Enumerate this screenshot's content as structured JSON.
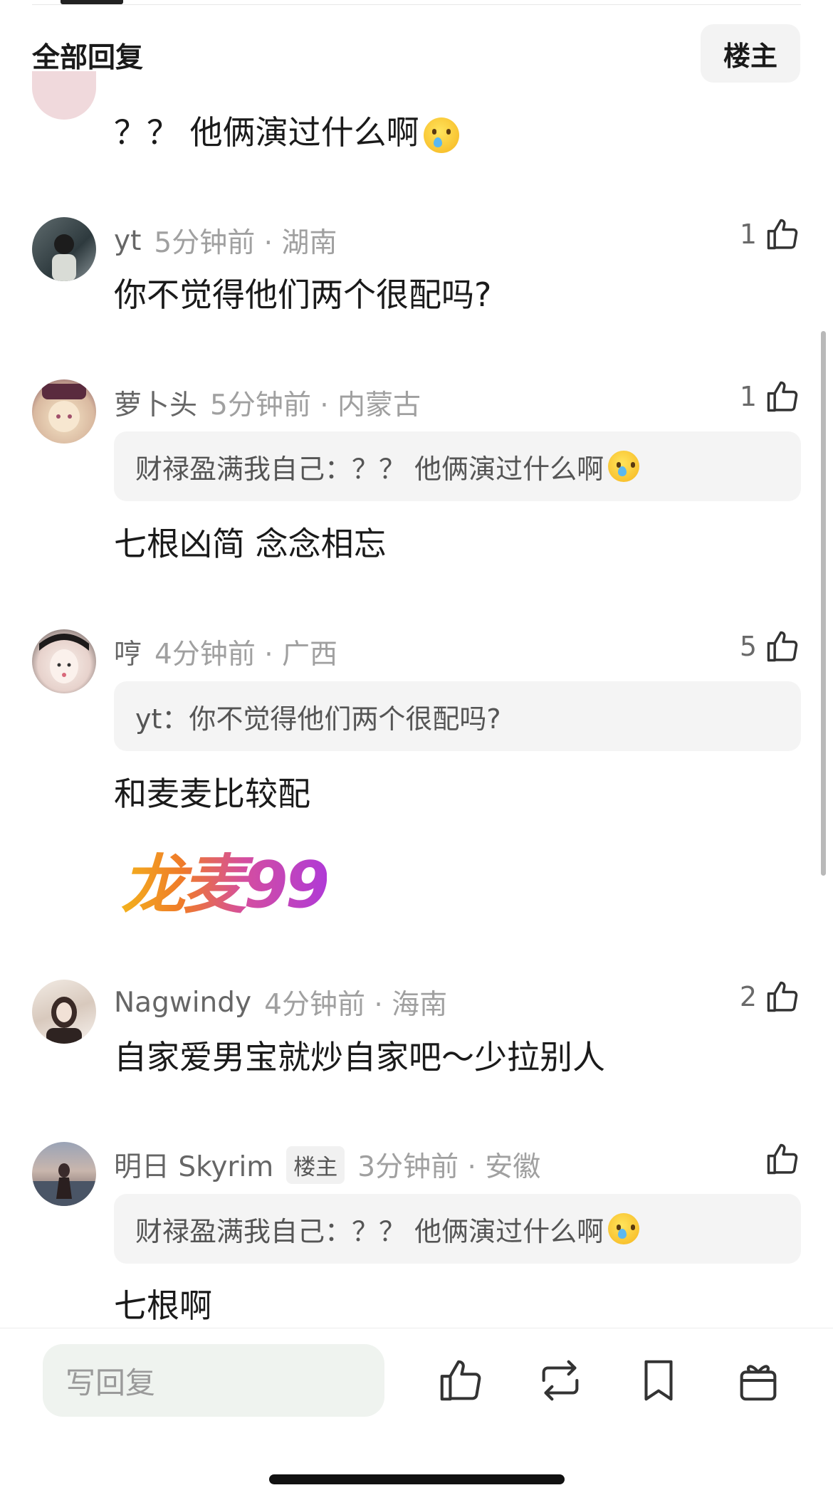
{
  "header": {
    "section_title": "全部回复",
    "filter_chip": "楼主"
  },
  "comments": [
    {
      "body": "？？ 他俩演过什么啊"
    },
    {
      "name": "yt",
      "meta": "5分钟前 · 湖南",
      "likes": "1",
      "body": "你不觉得他们两个很配吗?"
    },
    {
      "name": "萝卜头",
      "meta": "5分钟前 · 内蒙古",
      "likes": "1",
      "quote": "财禄盈满我自己：？？ 他俩演过什么啊",
      "body": "七根凶简 念念相忘"
    },
    {
      "name": "哼",
      "meta": "4分钟前 · 广西",
      "likes": "5",
      "quote": "yt：你不觉得他们两个很配吗?",
      "body": "和麦麦比较配",
      "sticker": "龙麦99"
    },
    {
      "name": "Nagwindy",
      "meta": "4分钟前 · 海南",
      "likes": "2",
      "body": "自家爱男宝就炒自家吧～少拉别人"
    },
    {
      "name": "明日 Skyrim",
      "tag": "楼主",
      "meta": "3分钟前 · 安徽",
      "likes": "",
      "quote": "财禄盈满我自己：？？ 他俩演过什么啊",
      "body": "七根啊"
    }
  ],
  "footer": {
    "reply_placeholder": "写回复"
  }
}
